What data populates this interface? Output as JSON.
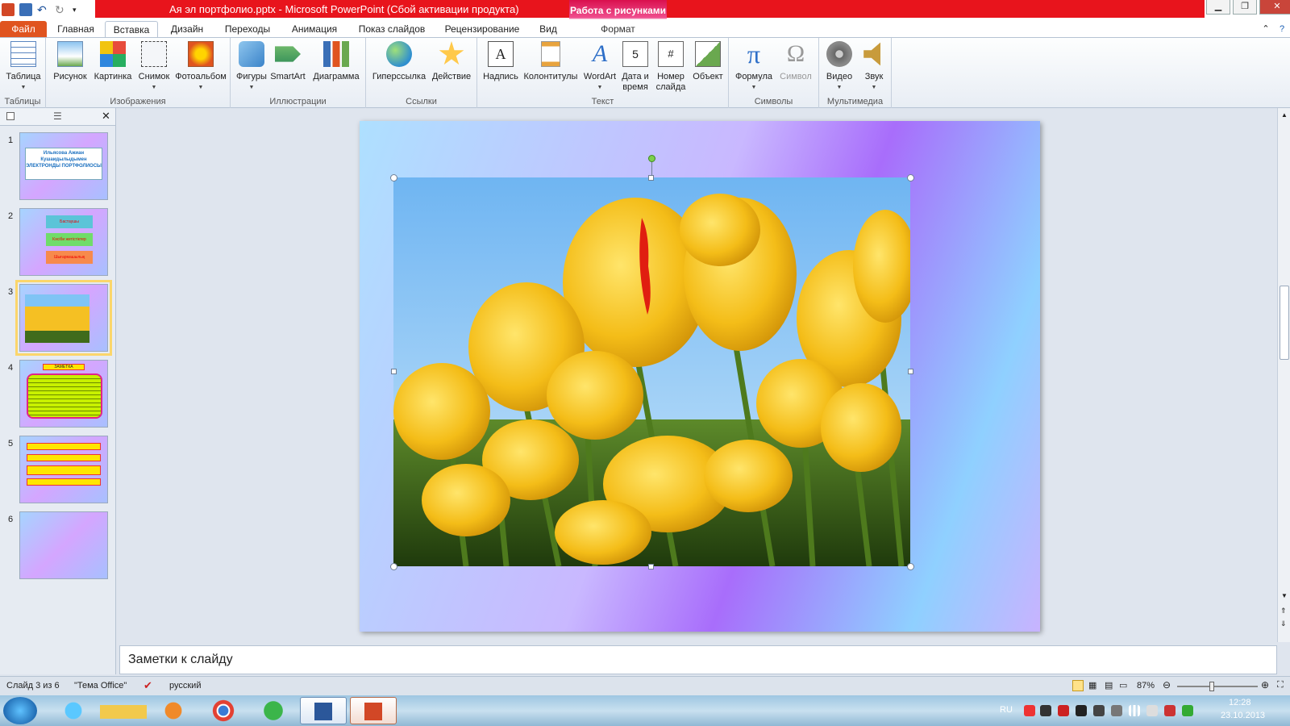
{
  "window": {
    "title": "Ая эл портфолио.pptx  -  Microsoft PowerPoint (Сбой активации продукта)",
    "context_tab_title": "Работа с рисунками",
    "accent_color": "#e8141c"
  },
  "tabs": {
    "file": "Файл",
    "home": "Главная",
    "insert": "Вставка",
    "design": "Дизайн",
    "transitions": "Переходы",
    "animation": "Анимация",
    "slideshow": "Показ слайдов",
    "review": "Рецензирование",
    "view": "Вид",
    "format": "Формат"
  },
  "ribbon": {
    "groups": {
      "tables": "Таблицы",
      "images": "Изображения",
      "illustrations": "Иллюстрации",
      "links": "Ссылки",
      "text": "Текст",
      "symbols": "Символы",
      "media": "Мультимедиа"
    },
    "buttons": {
      "table": "Таблица",
      "picture": "Рисунок",
      "clipart": "Картинка",
      "screenshot": "Снимок",
      "photoalbum": "Фотоальбом",
      "shapes": "Фигуры",
      "smartart": "SmartArt",
      "chart": "Диаграмма",
      "hyperlink": "Гиперссылка",
      "action": "Действие",
      "textbox": "Надпись",
      "headerfooter": "Колонтитулы",
      "wordart": "WordArt",
      "datetime_1": "Дата и",
      "datetime_2": "время",
      "slidenum_1": "Номер",
      "slidenum_2": "слайда",
      "object": "Объект",
      "equation": "Формула",
      "symbol": "Символ",
      "video": "Видео",
      "audio": "Звук"
    }
  },
  "slides": {
    "numbers": [
      "1",
      "2",
      "3",
      "4",
      "5",
      "6"
    ],
    "s1_title": "Ильясова Ажиан Кушаидылыдымен ЭЛЕКТРОНДЫ ПОРТФОЛИОСЫ",
    "s2_items": [
      "Бастаушы",
      "Кәсіби жетістіктер",
      "Шығармашылық"
    ],
    "s4_title": "ЗАМЕТКА"
  },
  "notes": {
    "placeholder": "Заметки к слайду"
  },
  "status": {
    "slide_info": "Слайд 3 из 6",
    "theme": "\"Тема Office\"",
    "language": "русский",
    "zoom": "87%",
    "zoom_level": 0.87
  },
  "taskbar": {
    "lang": "RU",
    "time": "12:28",
    "date": "23.10.2013"
  }
}
